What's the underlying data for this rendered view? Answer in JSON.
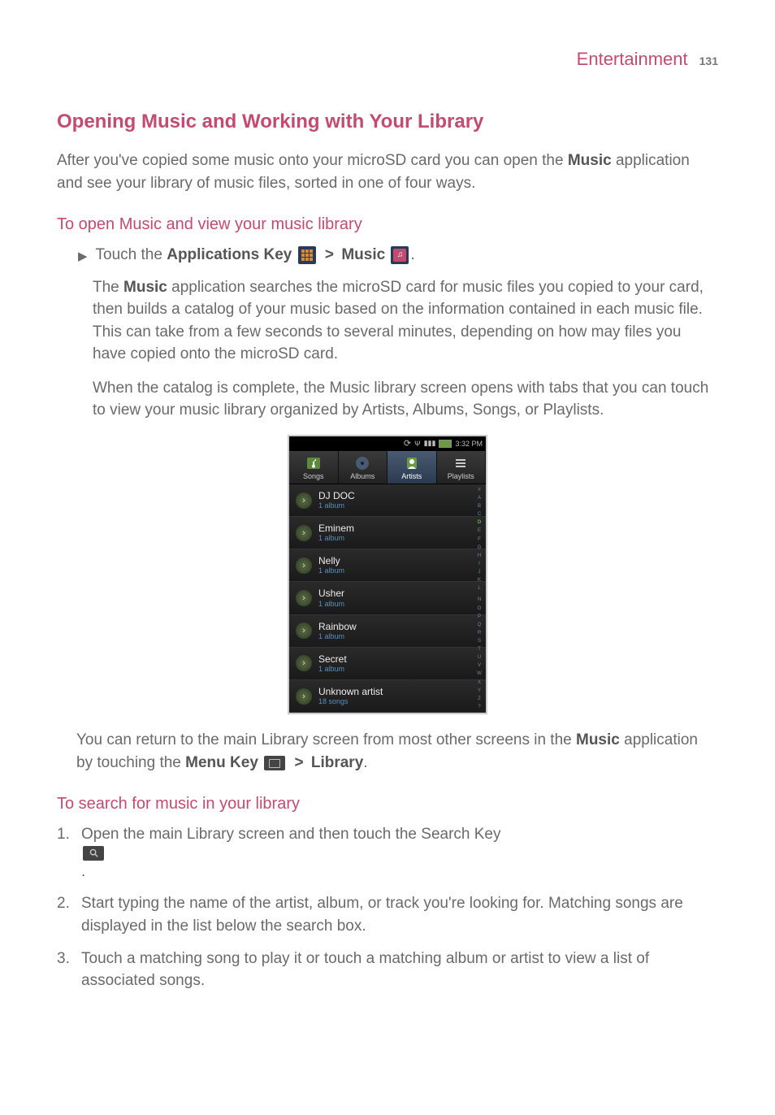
{
  "header": {
    "section": "Entertainment",
    "page_number": "131"
  },
  "h2_title": "Opening Music and Working with Your Library",
  "intro_before_music": "After you've copied some music onto your microSD card you can open the ",
  "intro_music": "Music",
  "intro_after_music": " application and see your library of music files, sorted in one of four ways.",
  "h3_open": "To open Music and view your music library",
  "step_touch_prefix": "Touch the ",
  "step_touch_apps_key": "Applications Key",
  "gt": " > ",
  "step_touch_music": "Music",
  "period": ".",
  "para_search_pre": "The ",
  "para_search_music": "Music",
  "para_search_post": " application searches the microSD card for music files you copied to your card, then builds a catalog of your music based on the information contained in each music file. This can take from a few seconds to several minutes, depending on how may files you have copied onto the microSD card.",
  "para_catalog": "When the catalog is complete, the Music library screen opens with tabs that you can touch to view your music library organized by Artists, Albums, Songs, or Playlists.",
  "return_pre": "You can return to the main Library screen from most other screens in the ",
  "return_music": "Music",
  "return_mid": " application by touching the ",
  "return_menu_key": "Menu Key",
  "return_library": "Library",
  "h3_search": "To search for music in your library",
  "step1_num": "1.",
  "step1_pre": "Open the main Library screen and then touch the ",
  "step1_search_key": "Search Key",
  "step2_num": "2.",
  "step2_text": "Start typing the name of the artist, album, or track you're looking for. Matching songs are displayed in the list below the search box.",
  "step3_num": "3.",
  "step3_text": "Touch a matching song to play it or touch a matching album or artist to view a list of associated songs.",
  "phone": {
    "status_time": "3:32 PM",
    "tabs": {
      "songs": "Songs",
      "albums": "Albums",
      "artists": "Artists",
      "playlists": "Playlists"
    },
    "artists": [
      {
        "name": "DJ DOC",
        "sub": "1 album"
      },
      {
        "name": "Eminem",
        "sub": "1 album"
      },
      {
        "name": "Nelly",
        "sub": "1 album"
      },
      {
        "name": "Usher",
        "sub": "1 album"
      },
      {
        "name": "Rainbow",
        "sub": "1 album"
      },
      {
        "name": "Secret",
        "sub": "1 album"
      },
      {
        "name": "Unknown artist",
        "sub": "18 songs"
      }
    ],
    "index": [
      "#",
      "A",
      "B",
      "C",
      "D",
      "E",
      "F",
      "G",
      "H",
      "I",
      "J",
      "K",
      "L",
      "M",
      "N",
      "O",
      "P",
      "Q",
      "R",
      "S",
      "T",
      "U",
      "V",
      "W",
      "X",
      "Y",
      "Z",
      "?"
    ]
  }
}
